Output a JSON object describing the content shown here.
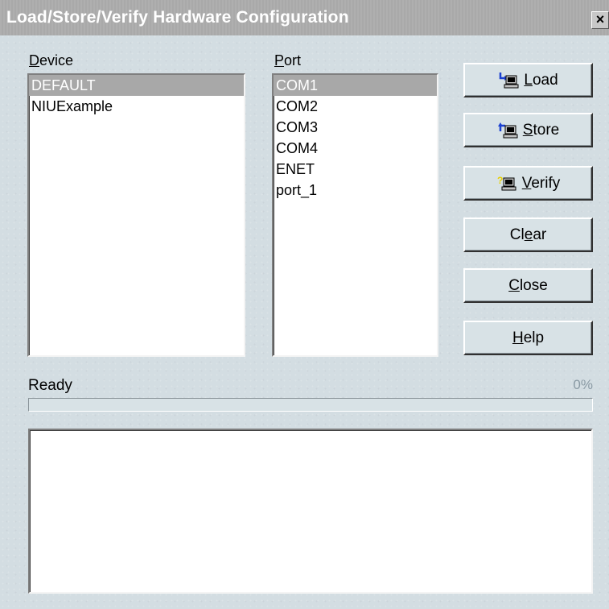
{
  "window": {
    "title": "Load/Store/Verify Hardware Configuration",
    "close_label": "×"
  },
  "device": {
    "label_accel": "D",
    "label_rest": "evice",
    "items": [
      "DEFAULT",
      "NIUExample"
    ],
    "selected": "DEFAULT"
  },
  "port": {
    "label_accel": "P",
    "label_rest": "ort",
    "items": [
      "COM1",
      "COM2",
      "COM3",
      "COM4",
      "ENET",
      "port_1"
    ],
    "selected": "COM1"
  },
  "buttons": {
    "load": {
      "pre": "",
      "accel": "L",
      "post": "oad"
    },
    "store": {
      "pre": "",
      "accel": "S",
      "post": "tore"
    },
    "verify": {
      "pre": "",
      "accel": "V",
      "post": "erify"
    },
    "clear": {
      "pre": "Cl",
      "accel": "e",
      "post": "ar"
    },
    "close": {
      "pre": "",
      "accel": "C",
      "post": "lose"
    },
    "help": {
      "pre": "",
      "accel": "H",
      "post": "elp"
    }
  },
  "status": {
    "text": "Ready",
    "percent_label": "0%",
    "progress": 0
  },
  "log": {
    "content": ""
  },
  "icons": {
    "load": "load-computer-icon",
    "store": "store-computer-icon",
    "verify": "verify-computer-icon"
  },
  "colors": {
    "selection": "#a8a8a8",
    "titlebar": "#a9a9a9",
    "dialog": "#d3dde2"
  }
}
